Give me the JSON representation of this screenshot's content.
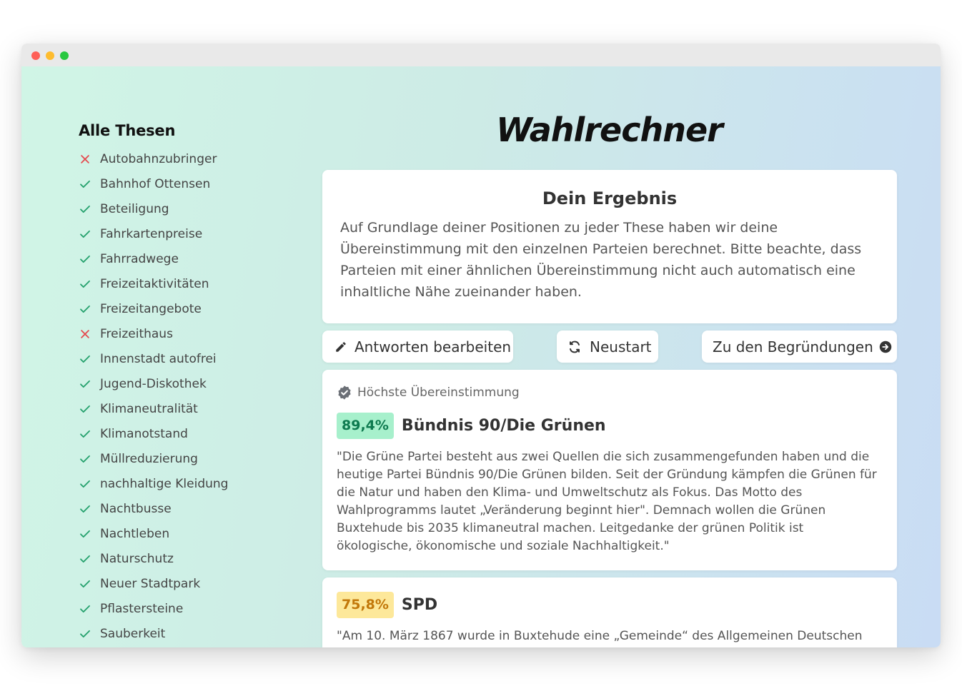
{
  "window": {
    "controls": [
      "close",
      "minimize",
      "maximize"
    ]
  },
  "app": {
    "title": "Wahlrechner"
  },
  "sidebar": {
    "title": "Alle Thesen",
    "items": [
      {
        "label": "Autobahnzubringer",
        "status": "rejected"
      },
      {
        "label": "Bahnhof Ottensen",
        "status": "agreed"
      },
      {
        "label": "Beteiligung",
        "status": "agreed"
      },
      {
        "label": "Fahrkartenpreise",
        "status": "agreed"
      },
      {
        "label": "Fahrradwege",
        "status": "agreed"
      },
      {
        "label": "Freizeitaktivitäten",
        "status": "agreed"
      },
      {
        "label": "Freizeitangebote",
        "status": "agreed"
      },
      {
        "label": "Freizeithaus",
        "status": "rejected"
      },
      {
        "label": "Innenstadt autofrei",
        "status": "agreed"
      },
      {
        "label": "Jugend-Diskothek",
        "status": "agreed"
      },
      {
        "label": "Klimaneutralität",
        "status": "agreed"
      },
      {
        "label": "Klimanotstand",
        "status": "agreed"
      },
      {
        "label": "Müllreduzierung",
        "status": "agreed"
      },
      {
        "label": "nachhaltige Kleidung",
        "status": "agreed"
      },
      {
        "label": "Nachtbusse",
        "status": "agreed"
      },
      {
        "label": "Nachtleben",
        "status": "agreed"
      },
      {
        "label": "Naturschutz",
        "status": "agreed"
      },
      {
        "label": "Neuer Stadtpark",
        "status": "agreed"
      },
      {
        "label": "Pflastersteine",
        "status": "agreed"
      },
      {
        "label": "Sauberkeit",
        "status": "agreed"
      }
    ]
  },
  "result": {
    "heading": "Dein Ergebnis",
    "text": "Auf Grundlage deiner Positionen zu jeder These haben wir deine Übereinstimmung mit den einzelnen Parteien berechnet. Bitte beachte, dass Parteien mit einer ähnlichen Übereinstimmung nicht auch automatisch eine inhaltliche Nähe zueinander haben."
  },
  "actions": {
    "edit_label": "Antworten bearbeiten",
    "restart_label": "Neustart",
    "reasons_label": "Zu den Begründungen"
  },
  "parties": [
    {
      "top_match_label": "Höchste Übereinstimmung",
      "percentage": "89,4%",
      "name": "Bündnis 90/Die Grünen",
      "description": "\"Die Grüne Partei besteht aus zwei Quellen die sich zusammengefunden haben und die heutige Partei Bündnis 90/Die Grünen bilden. Seit der Gründung kämpfen die Grünen für die Natur und haben den Klima- und Umweltschutz als Fokus. Das Motto des Wahlprogramms lautet „Veränderung beginnt hier\". Demnach wollen die Grünen Buxtehude bis 2035 klimaneutral machen. Leitgedanke der grünen Politik ist ökologische, ökonomische und soziale Nachhaltigkeit.\""
    },
    {
      "percentage": "75,8%",
      "name": "SPD",
      "description": "\"Am 10. März 1867 wurde in Buxtehude eine „Gemeinde“ des Allgemeinen Deutschen"
    }
  ],
  "colors": {
    "check": "#22a06b",
    "cross": "#e5484d",
    "badge_green_bg": "#a7f0cc",
    "badge_green_text": "#0e7a4f",
    "badge_yellow_bg": "#fde89a",
    "badge_yellow_text": "#c2780a"
  }
}
